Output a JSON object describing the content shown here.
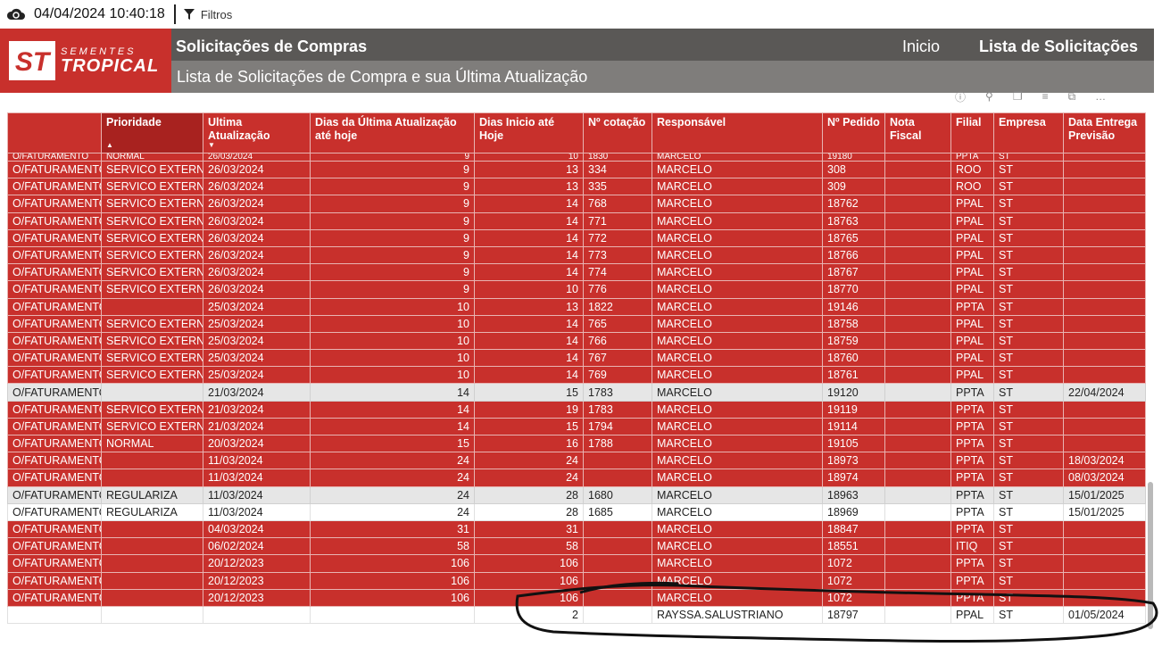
{
  "topbar": {
    "refresh_icon": "cloud-refresh-icon",
    "timestamp": "04/04/2024 10:40:18",
    "filter_label": "Filtros"
  },
  "header": {
    "brand_small": "SEMENTES",
    "brand_big": "TROPICAL",
    "title": "Solicitações de Compras",
    "nav_home": "Inicio",
    "nav_list": "Lista de Solicitações",
    "subtitle": "Lista de Solicitações de Compra e sua Última Atualização"
  },
  "columns": [
    "",
    "Prioridade",
    "Ultima Atualização",
    "Dias da Última Atualização até hoje",
    "Dias Inicio até Hoje",
    "Nº cotação",
    "Responsável",
    "Nº Pedido",
    "Nota Fiscal",
    "Filial",
    "Empresa",
    "Data Entrega Previsão"
  ],
  "top_row": [
    "O/FATURAMENTO",
    "NORMAL",
    "26/03/2024",
    "9",
    "10",
    "1830",
    "MARCELO",
    "19180",
    "",
    "PPTA",
    "ST",
    ""
  ],
  "rows": [
    {
      "s": "red",
      "c": [
        "O/FATURAMENTO",
        "SERVICO EXTERNO",
        "26/03/2024",
        "9",
        "13",
        "334",
        "MARCELO",
        "308",
        "",
        "ROO",
        "ST",
        ""
      ]
    },
    {
      "s": "red",
      "c": [
        "O/FATURAMENTO",
        "SERVICO EXTERNO",
        "26/03/2024",
        "9",
        "13",
        "335",
        "MARCELO",
        "309",
        "",
        "ROO",
        "ST",
        ""
      ]
    },
    {
      "s": "red",
      "c": [
        "O/FATURAMENTO",
        "SERVICO EXTERNO",
        "26/03/2024",
        "9",
        "14",
        "768",
        "MARCELO",
        "18762",
        "",
        "PPAL",
        "ST",
        ""
      ]
    },
    {
      "s": "red",
      "c": [
        "O/FATURAMENTO",
        "SERVICO EXTERNO",
        "26/03/2024",
        "9",
        "14",
        "771",
        "MARCELO",
        "18763",
        "",
        "PPAL",
        "ST",
        ""
      ]
    },
    {
      "s": "red",
      "c": [
        "O/FATURAMENTO",
        "SERVICO EXTERNO",
        "26/03/2024",
        "9",
        "14",
        "772",
        "MARCELO",
        "18765",
        "",
        "PPAL",
        "ST",
        ""
      ]
    },
    {
      "s": "red",
      "c": [
        "O/FATURAMENTO",
        "SERVICO EXTERNO",
        "26/03/2024",
        "9",
        "14",
        "773",
        "MARCELO",
        "18766",
        "",
        "PPAL",
        "ST",
        ""
      ]
    },
    {
      "s": "red",
      "c": [
        "O/FATURAMENTO",
        "SERVICO EXTERNO",
        "26/03/2024",
        "9",
        "14",
        "774",
        "MARCELO",
        "18767",
        "",
        "PPAL",
        "ST",
        ""
      ]
    },
    {
      "s": "red",
      "c": [
        "O/FATURAMENTO",
        "SERVICO EXTERNO",
        "26/03/2024",
        "9",
        "10",
        "776",
        "MARCELO",
        "18770",
        "",
        "PPAL",
        "ST",
        ""
      ]
    },
    {
      "s": "red",
      "c": [
        "O/FATURAMENTO",
        "",
        "25/03/2024",
        "10",
        "13",
        "1822",
        "MARCELO",
        "19146",
        "",
        "PPTA",
        "ST",
        ""
      ]
    },
    {
      "s": "red",
      "c": [
        "O/FATURAMENTO",
        "SERVICO EXTERNO",
        "25/03/2024",
        "10",
        "14",
        "765",
        "MARCELO",
        "18758",
        "",
        "PPAL",
        "ST",
        ""
      ]
    },
    {
      "s": "red",
      "c": [
        "O/FATURAMENTO",
        "SERVICO EXTERNO",
        "25/03/2024",
        "10",
        "14",
        "766",
        "MARCELO",
        "18759",
        "",
        "PPAL",
        "ST",
        ""
      ]
    },
    {
      "s": "red",
      "c": [
        "O/FATURAMENTO",
        "SERVICO EXTERNO",
        "25/03/2024",
        "10",
        "14",
        "767",
        "MARCELO",
        "18760",
        "",
        "PPAL",
        "ST",
        ""
      ]
    },
    {
      "s": "red",
      "c": [
        "O/FATURAMENTO",
        "SERVICO EXTERNO",
        "25/03/2024",
        "10",
        "14",
        "769",
        "MARCELO",
        "18761",
        "",
        "PPAL",
        "ST",
        ""
      ]
    },
    {
      "s": "grey",
      "c": [
        "O/FATURAMENTO",
        "",
        "21/03/2024",
        "14",
        "15",
        "1783",
        "MARCELO",
        "19120",
        "",
        "PPTA",
        "ST",
        "22/04/2024"
      ]
    },
    {
      "s": "red",
      "c": [
        "O/FATURAMENTO",
        "SERVICO EXTERNO",
        "21/03/2024",
        "14",
        "19",
        "1783",
        "MARCELO",
        "19119",
        "",
        "PPTA",
        "ST",
        ""
      ]
    },
    {
      "s": "red",
      "c": [
        "O/FATURAMENTO",
        "SERVICO EXTERNO",
        "21/03/2024",
        "14",
        "15",
        "1794",
        "MARCELO",
        "19114",
        "",
        "PPTA",
        "ST",
        ""
      ]
    },
    {
      "s": "red",
      "c": [
        "O/FATURAMENTO",
        "NORMAL",
        "20/03/2024",
        "15",
        "16",
        "1788",
        "MARCELO",
        "19105",
        "",
        "PPTA",
        "ST",
        ""
      ]
    },
    {
      "s": "red",
      "c": [
        "O/FATURAMENTO",
        "",
        "11/03/2024",
        "24",
        "24",
        "",
        "MARCELO",
        "18973",
        "",
        "PPTA",
        "ST",
        "18/03/2024"
      ]
    },
    {
      "s": "red",
      "c": [
        "O/FATURAMENTO",
        "",
        "11/03/2024",
        "24",
        "24",
        "",
        "MARCELO",
        "18974",
        "",
        "PPTA",
        "ST",
        "08/03/2024"
      ]
    },
    {
      "s": "grey",
      "c": [
        "O/FATURAMENTO",
        "REGULARIZA",
        "11/03/2024",
        "24",
        "28",
        "1680",
        "MARCELO",
        "18963",
        "",
        "PPTA",
        "ST",
        "15/01/2025"
      ]
    },
    {
      "s": "white",
      "c": [
        "O/FATURAMENTO",
        "REGULARIZA",
        "11/03/2024",
        "24",
        "28",
        "1685",
        "MARCELO",
        "18969",
        "",
        "PPTA",
        "ST",
        "15/01/2025"
      ]
    },
    {
      "s": "red",
      "c": [
        "O/FATURAMENTO",
        "",
        "04/03/2024",
        "31",
        "31",
        "",
        "MARCELO",
        "18847",
        "",
        "PPTA",
        "ST",
        ""
      ]
    },
    {
      "s": "red",
      "c": [
        "O/FATURAMENTO",
        "",
        "06/02/2024",
        "58",
        "58",
        "",
        "MARCELO",
        "18551",
        "",
        "ITIQ",
        "ST",
        ""
      ]
    },
    {
      "s": "red",
      "c": [
        "O/FATURAMENTO",
        "",
        "20/12/2023",
        "106",
        "106",
        "",
        "MARCELO",
        "1072",
        "",
        "PPTA",
        "ST",
        ""
      ]
    },
    {
      "s": "red",
      "c": [
        "O/FATURAMENTO",
        "",
        "20/12/2023",
        "106",
        "106",
        "",
        "MARCELO",
        "1072",
        "",
        "PPTA",
        "ST",
        ""
      ]
    },
    {
      "s": "red",
      "c": [
        "O/FATURAMENTO",
        "",
        "20/12/2023",
        "106",
        "106",
        "",
        "MARCELO",
        "1072",
        "",
        "PPTA",
        "ST",
        ""
      ]
    },
    {
      "s": "white",
      "c": [
        "",
        "",
        "",
        "",
        "2",
        "",
        "RAYSSA.SALUSTRIANO",
        "18797",
        "",
        "PPAL",
        "ST",
        "01/05/2024"
      ]
    }
  ],
  "visual_icons": [
    "info-icon",
    "pin-icon",
    "copy-icon",
    "filter-icon",
    "focus-icon",
    "more-icon"
  ],
  "colors": {
    "brand_red": "#c8302c",
    "header_grey": "#5a5856",
    "sub_grey": "#7f7d7b"
  }
}
